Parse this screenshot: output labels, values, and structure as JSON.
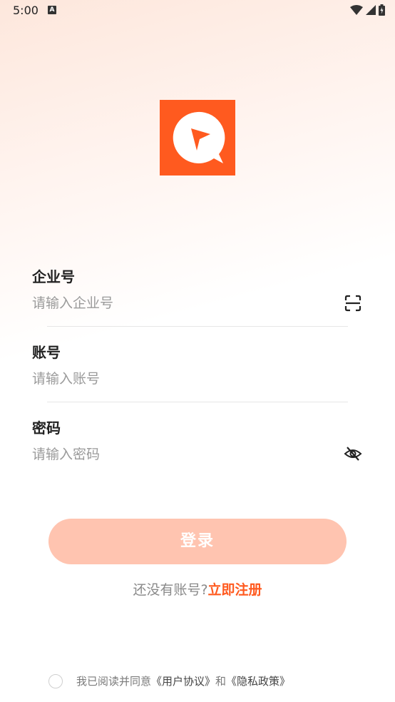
{
  "status_bar": {
    "time": "5:00",
    "notification_glyph": "A"
  },
  "form": {
    "company": {
      "label": "企业号",
      "placeholder": "请输入企业号",
      "value": ""
    },
    "account": {
      "label": "账号",
      "placeholder": "请输入账号",
      "value": ""
    },
    "password": {
      "label": "密码",
      "placeholder": "请输入密码",
      "value": ""
    }
  },
  "login_label": "登录",
  "register": {
    "prompt": "还没有账号?",
    "link": "立即注册"
  },
  "agreement": {
    "prefix": "我已阅读并同意",
    "user_agreement": "《用户协议》",
    "conjunction": "和",
    "privacy_policy": "《隐私政策》",
    "checked": false
  },
  "colors": {
    "accent": "#ff5a1f",
    "button_disabled": "#ffc4b0"
  },
  "icons": {
    "company_action": "scan-icon",
    "password_action": "eye-off-icon",
    "logo": "app-logo-icon"
  }
}
